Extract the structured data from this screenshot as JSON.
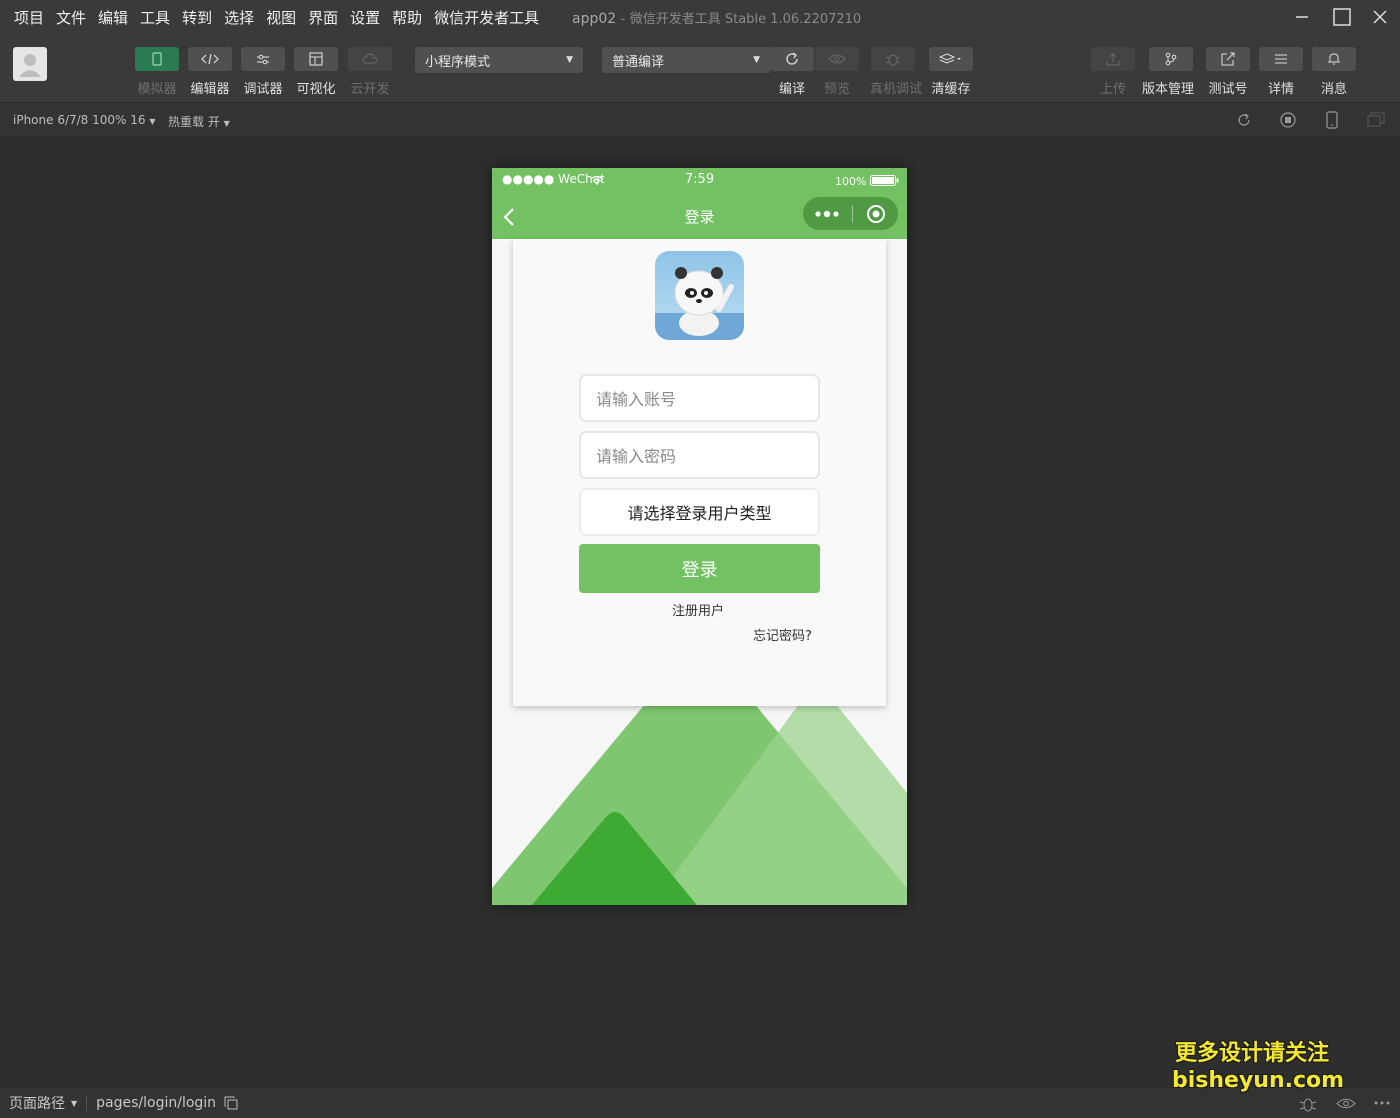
{
  "menu": {
    "items": [
      "项目",
      "文件",
      "编辑",
      "工具",
      "转到",
      "选择",
      "视图",
      "界面",
      "设置",
      "帮助",
      "微信开发者工具"
    ]
  },
  "window": {
    "app_name": "app02",
    "separator": "-",
    "product": "微信开发者工具 Stable 1.06.2207210"
  },
  "toolbar": {
    "simulator_label": "模拟器",
    "editor_label": "编辑器",
    "debugger_label": "调试器",
    "visual_label": "可视化",
    "cloud_label": "云开发",
    "mode_select": "小程序模式",
    "compile_select": "普通编译",
    "compile_label": "编译",
    "preview_label": "预览",
    "real_debug_label": "真机调试",
    "clear_cache_label": "清缓存",
    "upload_label": "上传",
    "version_label": "版本管理",
    "test_label": "测试号",
    "details_label": "详情",
    "messages_label": "消息"
  },
  "devicebar": {
    "device": "iPhone 6/7/8 100% 16",
    "hot_reload": "热重载 开"
  },
  "phone": {
    "status": {
      "carrier": "●●●●● WeChat",
      "time": "7:59",
      "battery": "100%"
    },
    "nav_title": "登录",
    "account_placeholder": "请输入账号",
    "password_placeholder": "请输入密码",
    "user_type_select": "请选择登录用户类型",
    "login_button": "登录",
    "register_link": "注册用户",
    "forgot_link": "忘记密码?"
  },
  "bottombar": {
    "path_label": "页面路径",
    "path_value": "pages/login/login"
  },
  "watermark": {
    "line1": "更多设计请关注",
    "line2": "bisheyun.com"
  },
  "colors": {
    "accent_green": "#73c163",
    "capsule_green": "#4f9a43",
    "simulator_btn": "#2a7a52",
    "watermark": "#f4e832"
  }
}
